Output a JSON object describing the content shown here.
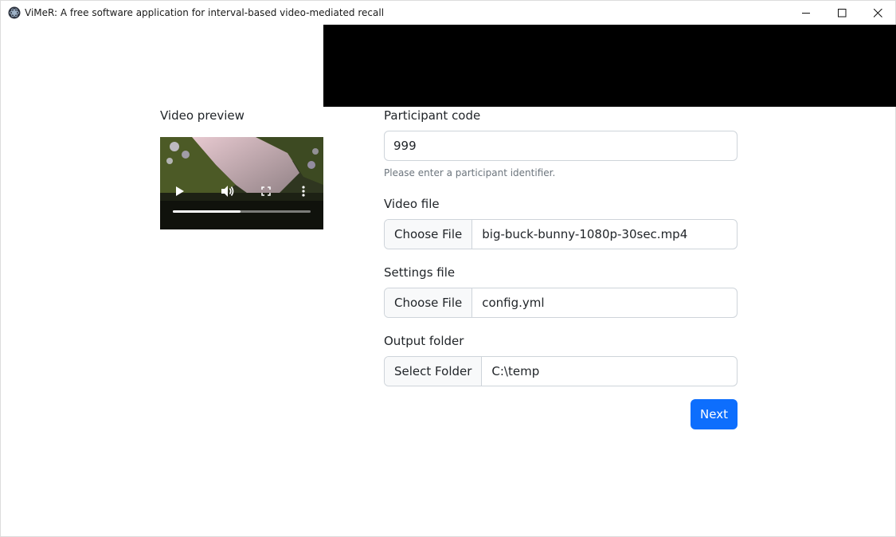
{
  "window": {
    "title": "ViMeR: A free software application for interval-based video-mediated recall"
  },
  "preview": {
    "label": "Video preview",
    "progress": 0.49
  },
  "participant": {
    "label": "Participant code",
    "value": "999",
    "hint": "Please enter a participant identifier."
  },
  "video_file": {
    "label": "Video file",
    "button": "Choose File",
    "value": "big-buck-bunny-1080p-30sec.mp4"
  },
  "settings_file": {
    "label": "Settings file",
    "button": "Choose File",
    "value": "config.yml"
  },
  "output_folder": {
    "label": "Output folder",
    "button": "Select Folder",
    "value": "C:\\temp"
  },
  "actions": {
    "next": "Next"
  },
  "colors": {
    "primary": "#0d6efd",
    "overlay": "#000000"
  }
}
